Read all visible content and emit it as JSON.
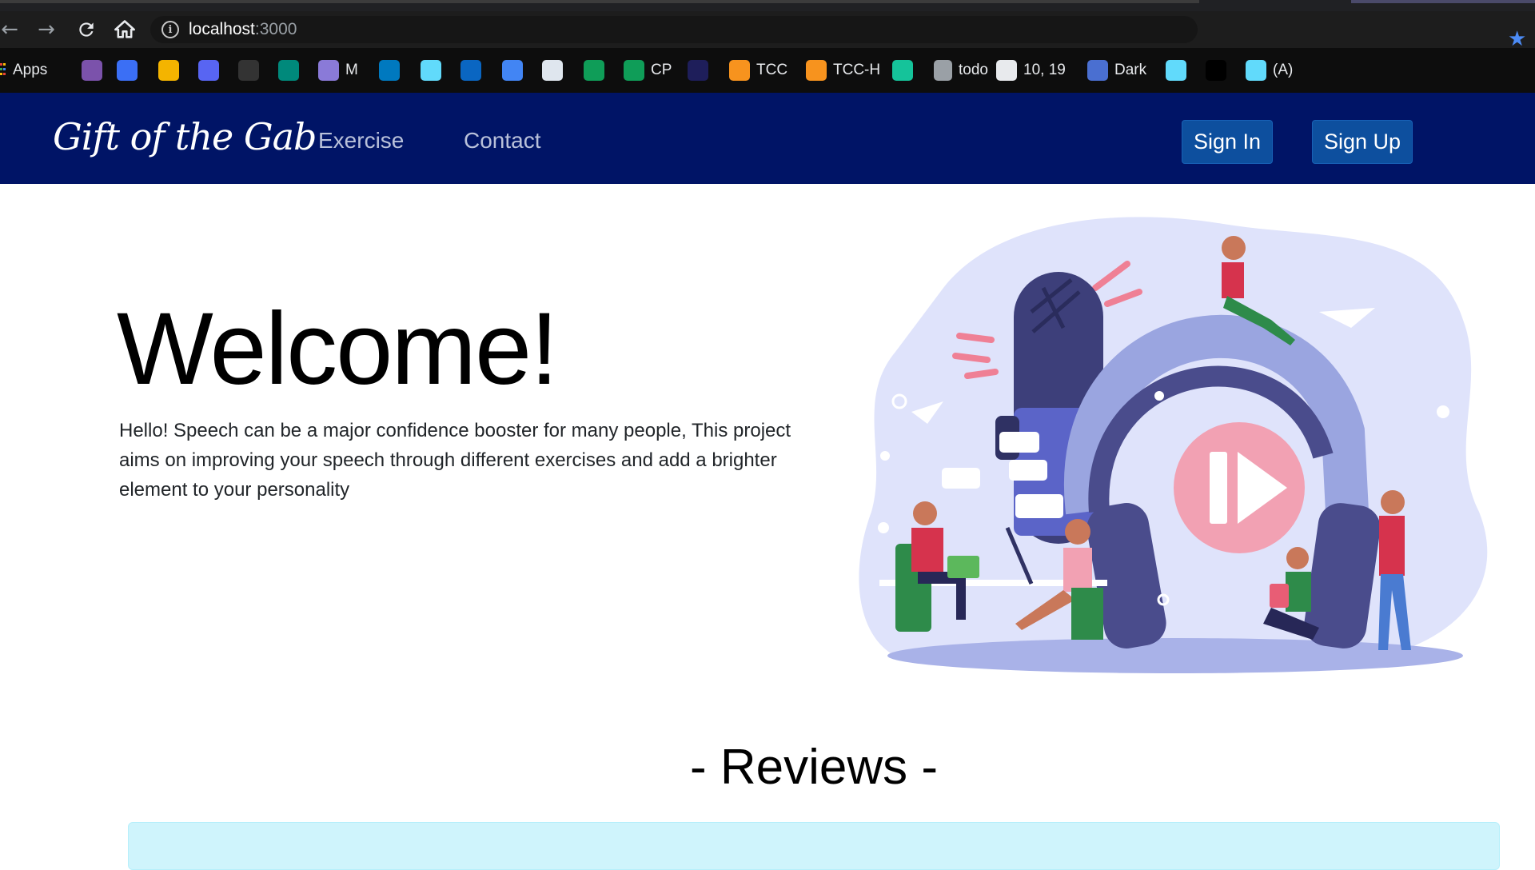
{
  "browser": {
    "url_host": "localhost",
    "url_port": ":3000",
    "bookmarks": [
      {
        "icon": "apps-grid-icon",
        "label": "Apps",
        "color": "#e8eaed"
      },
      {
        "icon": "lightning-icon",
        "label": "",
        "color": "#7b52ab"
      },
      {
        "icon": "c-letter-icon",
        "label": "",
        "color": "#3b6ff5"
      },
      {
        "icon": "classroom-icon",
        "label": "",
        "color": "#f4b400"
      },
      {
        "icon": "discord-icon",
        "label": "",
        "color": "#5865f2"
      },
      {
        "icon": "github-icon",
        "label": "",
        "color": "#333333"
      },
      {
        "icon": "meet-icon",
        "label": "",
        "color": "#00897b"
      },
      {
        "icon": "globe-icon",
        "label": "M",
        "color": "#8a7ad8"
      },
      {
        "icon": "trello-icon",
        "label": "",
        "color": "#0079bf"
      },
      {
        "icon": "react-icon",
        "label": "",
        "color": "#61dafb"
      },
      {
        "icon": "linkedin-icon",
        "label": "",
        "color": "#0a66c2"
      },
      {
        "icon": "docs-icon",
        "label": "",
        "color": "#4285f4"
      },
      {
        "icon": "mountain-icon",
        "label": "",
        "color": "#dfe6ee"
      },
      {
        "icon": "drive-icon",
        "label": "",
        "color": "#0f9d58"
      },
      {
        "icon": "drive-icon",
        "label": "CP",
        "color": "#0f9d58"
      },
      {
        "icon": "r-letter-icon",
        "label": "",
        "color": "#1e1e5a"
      },
      {
        "icon": "codechef-icon",
        "label": "TCC",
        "color": "#f7931e"
      },
      {
        "icon": "codechef-icon",
        "label": "TCC-H",
        "color": "#f7931e"
      },
      {
        "icon": "grammarly-icon",
        "label": "",
        "color": "#15c39a"
      },
      {
        "icon": "react-icon",
        "label": "todo",
        "color": "#9aa0a6"
      },
      {
        "icon": "cloud-icon",
        "label": "10, 19",
        "color": "#e8eaed"
      },
      {
        "icon": "p-letter-icon",
        "label": "Dark",
        "color": "#4a6fd1"
      },
      {
        "icon": "react-icon",
        "label": "",
        "color": "#61dafb"
      },
      {
        "icon": "dev-icon",
        "label": "",
        "color": "#000000"
      },
      {
        "icon": "react-icon",
        "label": "(A)",
        "color": "#61dafb"
      }
    ]
  },
  "navbar": {
    "brand": "Gift of the Gab",
    "links": [
      "Exercise",
      "Contact"
    ],
    "sign_in": "Sign In",
    "sign_up": "Sign Up",
    "bg_color": "#001466",
    "button_color": "#0d4f9e"
  },
  "hero": {
    "title": "Welcome!",
    "text": "Hello! Speech can be a major confidence booster for many people, This project aims on improving your speech through different exercises and add a brighter element to your personality"
  },
  "reviews": {
    "title": "- Reviews -"
  }
}
